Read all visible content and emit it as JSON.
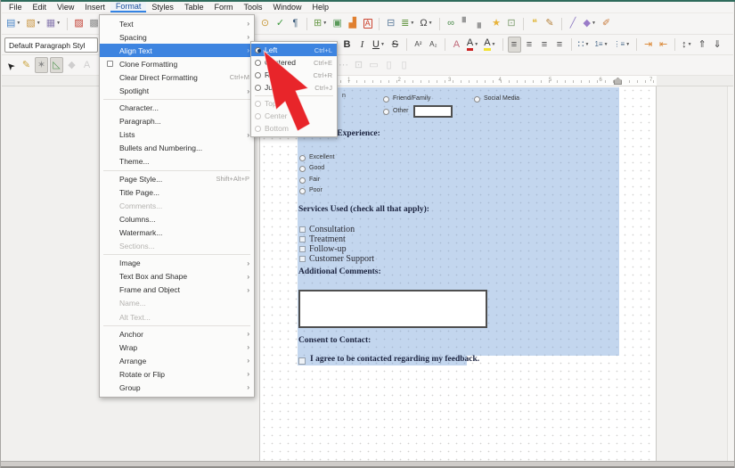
{
  "menubar": {
    "items": [
      "File",
      "Edit",
      "View",
      "Insert",
      "Format",
      "Styles",
      "Table",
      "Form",
      "Tools",
      "Window",
      "Help"
    ],
    "active_item": "Format"
  },
  "standard_toolbar_left": [
    {
      "name": "new-document-button",
      "glyph": "▤",
      "color": "#4a86c8",
      "dropdown": true
    },
    {
      "name": "open-button",
      "glyph": "▧",
      "color": "#c8933d",
      "dropdown": true
    },
    {
      "name": "save-button",
      "glyph": "▦",
      "color": "#8a7cb0",
      "dropdown": true
    },
    {
      "sep": true
    },
    {
      "name": "export-pdf-button",
      "glyph": "▨",
      "color": "#c03a2e"
    },
    {
      "name": "print-button",
      "glyph": "▩",
      "color": "#8a8a8a"
    }
  ],
  "standard_toolbar_right": [
    {
      "name": "find-replace-button",
      "glyph": "⊙",
      "color": "#c89a3d"
    },
    {
      "name": "spellcheck-button",
      "glyph": "✓",
      "color": "#3f9a3f"
    },
    {
      "name": "formatting-marks-button",
      "glyph": "¶",
      "color": "#3a5a7a"
    },
    {
      "sep": true
    },
    {
      "name": "insert-table-button",
      "glyph": "⊞",
      "color": "#6a9a4a",
      "dropdown": true
    },
    {
      "name": "insert-image-button",
      "glyph": "▣",
      "color": "#5a9a5a"
    },
    {
      "name": "insert-chart-button",
      "glyph": "▟",
      "color": "#e08030"
    },
    {
      "name": "insert-textbox-button",
      "glyph": "A",
      "color": "#cc4430",
      "boxed": true
    },
    {
      "sep": true
    },
    {
      "name": "insert-pagebreak-button",
      "glyph": "⊟",
      "color": "#5a7a9a"
    },
    {
      "name": "insert-field-button",
      "glyph": "≣",
      "color": "#6a9a4a",
      "dropdown": true
    },
    {
      "name": "special-character-button",
      "glyph": "Ω",
      "color": "#444444",
      "dropdown": true
    },
    {
      "sep": true
    },
    {
      "name": "insert-hyperlink-button",
      "glyph": "∞",
      "color": "#4a8a4a"
    },
    {
      "name": "insert-header-button",
      "glyph": "▘",
      "color": "#999999"
    },
    {
      "name": "insert-footer-button",
      "glyph": "▖",
      "color": "#999999"
    },
    {
      "name": "insert-bookmark-button",
      "glyph": "★",
      "color": "#e8b33a"
    },
    {
      "name": "cross-reference-button",
      "glyph": "⊡",
      "color": "#7a9a6a"
    },
    {
      "sep": true
    },
    {
      "name": "insert-comment-button",
      "glyph": "❝",
      "color": "#e0b63a"
    },
    {
      "name": "track-changes-button",
      "glyph": "✎",
      "color": "#b5803a"
    },
    {
      "sep": true
    },
    {
      "name": "insert-line-button",
      "glyph": "╱",
      "color": "#8e7cc3"
    },
    {
      "name": "basic-shapes-button",
      "glyph": "◆",
      "color": "#9a7cc8",
      "dropdown": true
    },
    {
      "name": "draw-functions-button",
      "glyph": "✐",
      "color": "#c87a3a"
    }
  ],
  "formatting_toolbar": {
    "style_combo_value": "Default Paragraph Styl",
    "buttons": [
      {
        "name": "bold-button",
        "glyph": "B",
        "color": "#333333",
        "weight": "bold"
      },
      {
        "name": "italic-button",
        "glyph": "I",
        "color": "#333333",
        "style": "italic",
        "serif": true
      },
      {
        "name": "underline-button",
        "glyph": "U",
        "color": "#333333",
        "deco": "underline",
        "dropdown": true
      },
      {
        "name": "strikethrough-button",
        "glyph": "S",
        "color": "#333333",
        "deco": "line-through"
      },
      {
        "sep": true
      },
      {
        "name": "superscript-button",
        "glyph": "A²",
        "color": "#444444"
      },
      {
        "name": "subscript-button",
        "glyph": "A₂",
        "color": "#444444"
      },
      {
        "sep": true
      },
      {
        "name": "clear-formatting-button",
        "glyph": "A",
        "color": "#c06a7a"
      },
      {
        "name": "font-color-button",
        "glyph": "A",
        "color": "#333333",
        "underbar": "#cc2222",
        "dropdown": true
      },
      {
        "name": "highlight-color-button",
        "glyph": "A",
        "color": "#333333",
        "underbar": "#f2e230",
        "dropdown": true
      },
      {
        "sep": true
      },
      {
        "name": "align-left-button",
        "glyph": "≡",
        "color": "#4a4a4a",
        "active": true
      },
      {
        "name": "align-center-button",
        "glyph": "≡",
        "color": "#4a4a4a"
      },
      {
        "name": "align-right-button",
        "glyph": "≡",
        "color": "#4a4a4a"
      },
      {
        "name": "align-justify-button",
        "glyph": "≡",
        "color": "#4a4a4a"
      },
      {
        "sep": true
      },
      {
        "name": "bullet-list-button",
        "glyph": "∷",
        "color": "#4a6a8a",
        "dropdown": true
      },
      {
        "name": "numbered-list-button",
        "glyph": "1≡",
        "color": "#4a6a8a",
        "dropdown": true
      },
      {
        "name": "outline-list-button",
        "glyph": "⋮≡",
        "color": "#4a6a8a",
        "dropdown": true
      },
      {
        "sep": true
      },
      {
        "name": "increase-indent-button",
        "glyph": "⇥",
        "color": "#d9822b"
      },
      {
        "name": "decrease-indent-button",
        "glyph": "⇤",
        "color": "#d9822b"
      },
      {
        "sep": true
      },
      {
        "name": "line-spacing-button",
        "glyph": "↕",
        "color": "#4a4a4a",
        "dropdown": true
      },
      {
        "name": "increase-paragraph-spacing-button",
        "glyph": "⇑",
        "color": "#4a4a4a"
      },
      {
        "name": "decrease-paragraph-spacing-button",
        "glyph": "⇓",
        "color": "#4a4a4a"
      }
    ]
  },
  "form_toolbar_left": [
    {
      "name": "select-pointer-button",
      "glyph": "➤",
      "color": "#222222",
      "rotate": -135
    },
    {
      "name": "design-mode-button",
      "glyph": "✎",
      "color": "#caa23a"
    },
    {
      "name": "control-wizards-button",
      "glyph": "✶",
      "color": "#8a8a8a",
      "active": true
    },
    {
      "name": "form-design-button",
      "glyph": "◺",
      "color": "#5a9a5a",
      "active": true
    },
    {
      "name": "shape-control-icon",
      "glyph": "◆",
      "color": "#9a9a9a",
      "disabled": true
    },
    {
      "name": "label-field-icon",
      "glyph": "A",
      "color": "#9a9a9a",
      "disabled": true
    }
  ],
  "form_toolbar_right": [
    {
      "name": "more-controls-icon",
      "glyph": "⋯",
      "color": "#9a9a9a",
      "disabled": true
    },
    {
      "name": "form-navigator-icon",
      "glyph": "⊡",
      "color": "#9a9a9a",
      "disabled": true
    },
    {
      "name": "data-source-icon",
      "glyph": "▭",
      "color": "#9a9a9a",
      "disabled": true
    },
    {
      "name": "spin-button-icon",
      "glyph": "▯",
      "color": "#9a9a9a",
      "disabled": true
    },
    {
      "name": "scrollbar-control-icon",
      "glyph": "▯",
      "color": "#9a9a9a",
      "disabled": true
    }
  ],
  "format_menu": [
    {
      "label": "Text",
      "submenu": true
    },
    {
      "label": "Spacing",
      "submenu": true
    },
    {
      "label": "Align Text",
      "submenu": true,
      "highlighted": true
    },
    {
      "label": "Clone Formatting",
      "checkbox": true
    },
    {
      "label": "Clear Direct Formatting",
      "shortcut": "Ctrl+M"
    },
    {
      "label": "Spotlight",
      "submenu": true
    },
    {
      "separator": true
    },
    {
      "label": "Character..."
    },
    {
      "label": "Paragraph..."
    },
    {
      "label": "Lists",
      "submenu": true
    },
    {
      "label": "Bullets and Numbering..."
    },
    {
      "label": "Theme..."
    },
    {
      "separator": true
    },
    {
      "label": "Page Style...",
      "shortcut": "Shift+Alt+P"
    },
    {
      "label": "Title Page..."
    },
    {
      "label": "Comments...",
      "disabled": true
    },
    {
      "label": "Columns..."
    },
    {
      "label": "Watermark..."
    },
    {
      "label": "Sections...",
      "disabled": true
    },
    {
      "separator": true
    },
    {
      "label": "Image",
      "submenu": true
    },
    {
      "label": "Text Box and Shape",
      "submenu": true
    },
    {
      "label": "Frame and Object",
      "submenu": true
    },
    {
      "label": "Name...",
      "disabled": true
    },
    {
      "label": "Alt Text...",
      "disabled": true
    },
    {
      "separator": true
    },
    {
      "label": "Anchor",
      "submenu": true
    },
    {
      "label": "Wrap",
      "submenu": true
    },
    {
      "label": "Arrange",
      "submenu": true
    },
    {
      "label": "Rotate or Flip",
      "submenu": true
    },
    {
      "label": "Group",
      "submenu": true
    }
  ],
  "align_submenu": [
    {
      "label": "Left",
      "shortcut": "Ctrl+L",
      "radio": true,
      "selected": true,
      "highlighted": true
    },
    {
      "label": "Centered",
      "shortcut": "Ctrl+E",
      "radio": true
    },
    {
      "label": "Right",
      "shortcut": "Ctrl+R",
      "radio": true
    },
    {
      "label": "Justified",
      "shortcut": "Ctrl+J",
      "radio": true
    },
    {
      "separator": true
    },
    {
      "label": "Top",
      "radio": true,
      "disabled": true
    },
    {
      "label": "Center",
      "radio": true,
      "disabled": true
    },
    {
      "label": "Bottom",
      "radio": true,
      "disabled": true
    }
  ],
  "ruler": {
    "numbers": [
      "1",
      "2",
      "3",
      "4",
      "5",
      "6",
      "7"
    ]
  },
  "document": {
    "fragment_text": "n",
    "source_options": [
      "Friend/Family",
      "Social Media"
    ],
    "other_label": "Other",
    "rate_heading": "Rate Your Experience:",
    "rate_options": [
      "Excellent",
      "Good",
      "Fair",
      "Poor"
    ],
    "services_heading": "Services Used (check all that apply):",
    "services_options": [
      "Consultation",
      "Treatment",
      "Follow-up",
      "Customer Support"
    ],
    "comments_heading": "Additional Comments:",
    "consent_heading": "Consent to Contact:",
    "consent_text": "I agree to be contacted regarding my feedback."
  },
  "colors": {
    "menu_highlight": "#3d84e0",
    "selection_blue": "rgba(112,158,214,0.42)",
    "cursor_red": "#e8252a",
    "window_top_green": "#2f6b5c"
  }
}
